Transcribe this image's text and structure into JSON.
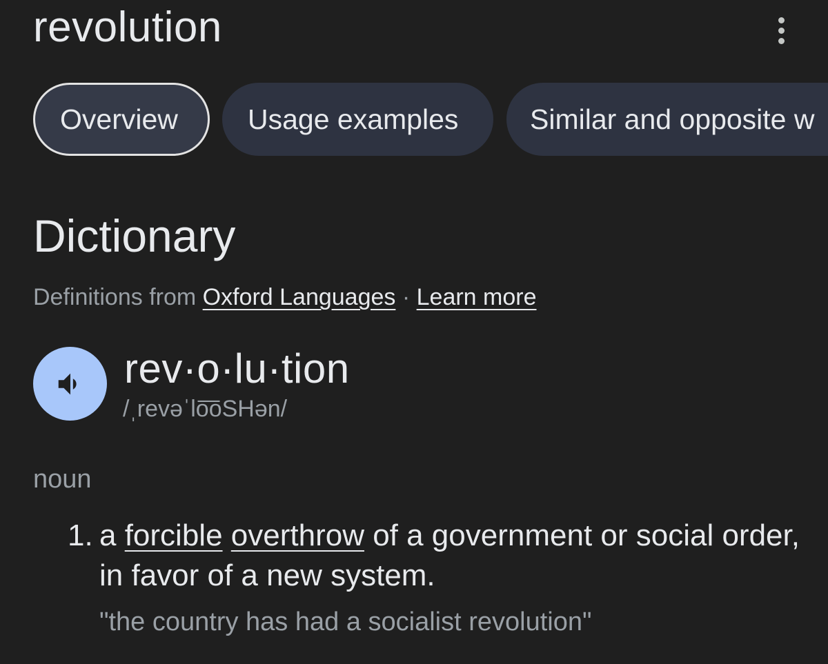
{
  "header": {
    "title": "revolution",
    "more_icon": "more-vert-icon"
  },
  "tabs": [
    {
      "label": "Overview",
      "active": true
    },
    {
      "label": "Usage examples",
      "active": false
    },
    {
      "label": "Similar and opposite w",
      "active": false
    }
  ],
  "dictionary": {
    "heading": "Dictionary",
    "source_prefix": "Definitions from ",
    "source_link": "Oxford Languages",
    "separator": " · ",
    "learn_more": "Learn more",
    "speaker_icon": "volume-icon",
    "headword": "rev·o·lu·tion",
    "phonetic": "/ˌrevəˈlo͞oSHən/",
    "part_of_speech": "noun",
    "definitions": [
      {
        "number": "1.",
        "prefix": "a ",
        "link1": "forcible",
        "space": " ",
        "link2": "overthrow",
        "rest": " of a government or social order, in favor of a new system.",
        "example": "\"the country has had a socialist revolution\""
      }
    ]
  },
  "colors": {
    "background": "#1f1f1f",
    "chip": "#2e3341",
    "speaker": "#a8c7fa",
    "muted_text": "#9aa0a6"
  }
}
